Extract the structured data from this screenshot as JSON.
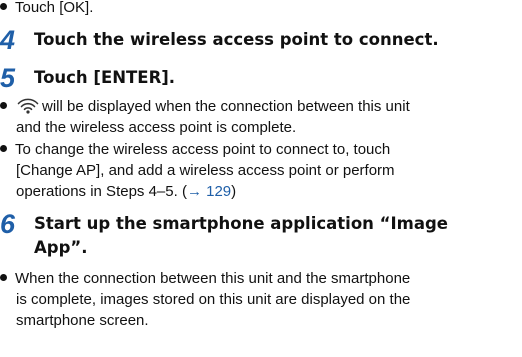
{
  "bullet_touch_ok": "Touch [OK].",
  "step4": {
    "number": "4",
    "text": "Touch the wireless access point to connect."
  },
  "step5": {
    "number": "5",
    "text": "Touch [ENTER].",
    "bullet1": {
      "line1_after_icon": "will be displayed when the connection between this unit",
      "line2": "and the wireless access point is complete."
    },
    "bullet2": {
      "line1": "To change the wireless access point to connect to, touch",
      "line2": "[Change AP], and add a wireless access point or perform",
      "line3_text": "operations in Steps 4–5. (",
      "line3_ref": "→ 129",
      "line3_close": ")"
    }
  },
  "step6": {
    "number": "6",
    "text_line1": "Start up the smartphone application “Image",
    "text_line2": "App”.",
    "bullet": {
      "line1": "When the connection between this unit and the smartphone",
      "line2": "is complete, images stored on this unit are displayed on the",
      "line3": "smartphone screen."
    }
  },
  "icons": {
    "wifi": "wifi-connected-icon"
  },
  "colors": {
    "step_number": "#1f5fa8",
    "link": "#1f5fa8",
    "text": "#111111"
  }
}
